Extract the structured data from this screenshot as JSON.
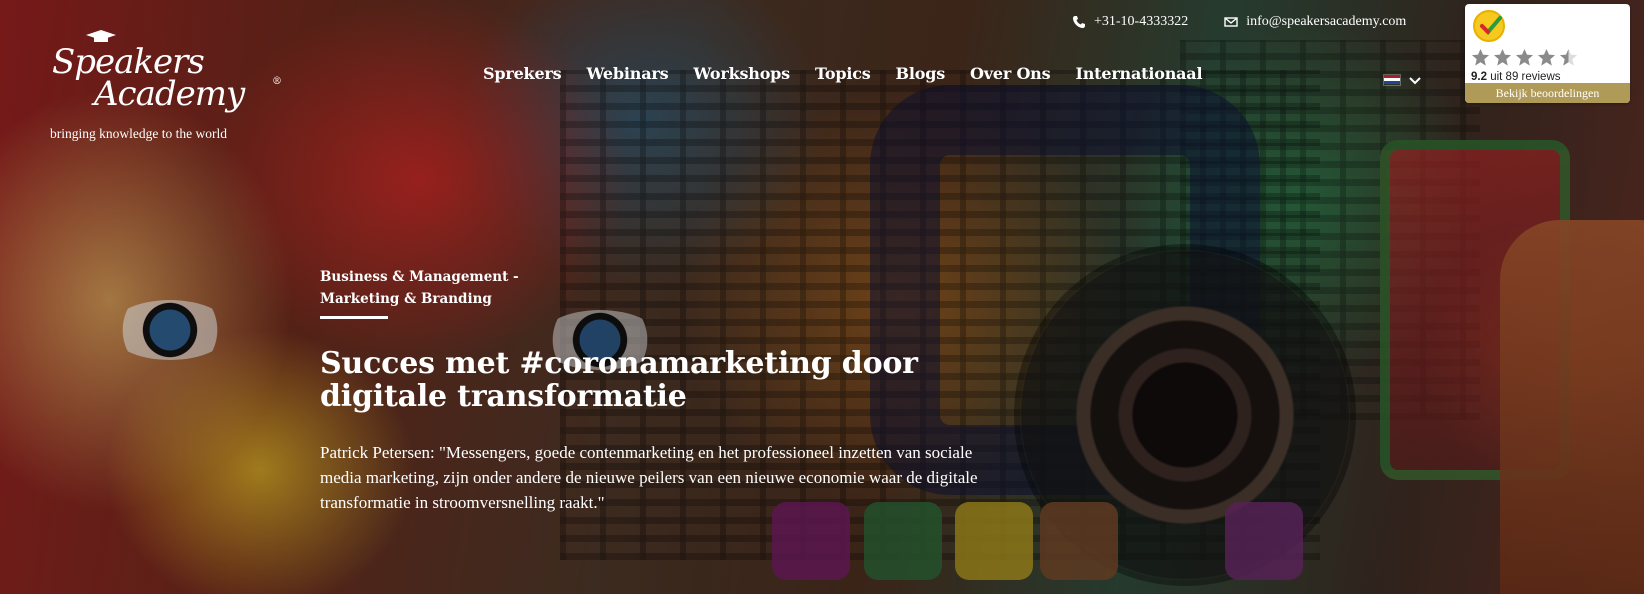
{
  "logo": {
    "word1": "Speakers",
    "word2": "Academy",
    "registered": "®",
    "tagline": "bringing knowledge to the world"
  },
  "contact": {
    "phone": "+31-10-4333322",
    "email": "info@speakersacademy.com",
    "phone_icon": "phone-icon",
    "email_icon": "envelope-icon"
  },
  "nav": {
    "items": [
      {
        "label": "Sprekers"
      },
      {
        "label": "Webinars"
      },
      {
        "label": "Workshops"
      },
      {
        "label": "Topics"
      },
      {
        "label": "Blogs"
      },
      {
        "label": "Over Ons"
      },
      {
        "label": "Internationaal"
      }
    ]
  },
  "language": {
    "flag": "netherlands-flag-icon",
    "flag_colors": [
      "#ae1c28",
      "#ffffff",
      "#21468b"
    ],
    "chevron": "chevron-down-icon"
  },
  "review": {
    "badge_icon": "kiyoh-checkmark-icon",
    "rating": 4.5,
    "max_rating": 5,
    "score": "9.2",
    "reviews_text": "uit 89 reviews",
    "button_label": "Bekijk beoordelingen",
    "button_color": "#b09a57"
  },
  "hero": {
    "category_line1": "Business & Management -",
    "category_line2": "Marketing & Branding",
    "title": "Succes met #coronamarketing door digitale transformatie",
    "description": "Patrick Petersen: \"Messengers, goede contenmarketing en het professioneel inzetten van sociale media marketing, zijn onder andere de nieuwe peilers van een nieuwe economie waar de digitale transformatie in stroomversnelling raakt.\""
  }
}
